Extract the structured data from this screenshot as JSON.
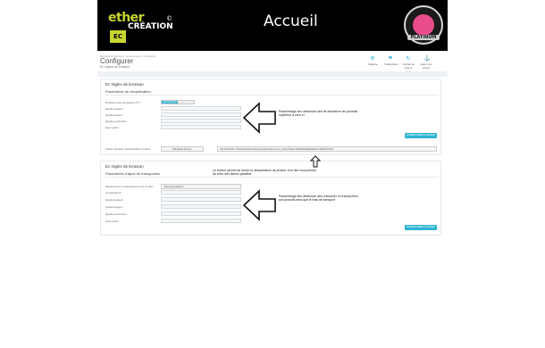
{
  "banner": {
    "logo_text": "ether",
    "logo_sub": "CRÉATION",
    "logo_mark": "EC",
    "logo_reg": "©",
    "title": "Accueil",
    "badge_text": "PLATINUM"
  },
  "topbar": {
    "breadcrumb": "Modules & Services  /  Gestionnaire  /  Configurer",
    "title": "Configurer",
    "subtitle": "Ec règles de livraison",
    "tools": [
      {
        "label": "Traduire",
        "icon": "gear-icon"
      },
      {
        "label": "Traductions",
        "icon": "flag-icon"
      },
      {
        "label": "Vérifier la mise à jour",
        "icon": "refresh-icon"
      },
      {
        "label": "Gérer vos points",
        "icon": "hook-icon"
      }
    ]
  },
  "panel1": {
    "heading": "Ec règles de livraison",
    "subheading": "Paramètres de désactivation",
    "fields": [
      "Produits sous dimension (?) ?",
      "Quelle hauteur :",
      "Quelle largeur :",
      "Quelle profondeur :",
      "Quel poids :"
    ],
    "toggle_on": "ACTIVÉ /OUI",
    "toggle_off": "",
    "save_label": "ENREGISTRER & LANCER",
    "link_label": "Tâche planifiée désactivation produits",
    "link_button": "Démarrer la cron",
    "url_value": "http://193.184.1.15/prestashop/modules/ecreglelivraison/cron_all.php?token=6db2f6b3e86a6f4e0d7ca8fba78c0a72"
  },
  "panel2": {
    "heading": "Ec règles de livraison",
    "subheading": "Paramètres d'ajout de transporteur",
    "fields": [
      "Sélectionnez le transporteur (sur le site) :",
      "Comparateur",
      "Quelle hauteur :",
      "Quelle largeur :",
      "Quelle profondeur :",
      "Quel poids :"
    ],
    "carrier_value": "Exemple platform",
    "save_label": "ENREGISTRER & LANCER"
  },
  "annotations": {
    "note1": "Paramétrage des dimension afin de désactiver les produits supérieur à ceux ci",
    "note2": "Le bouton permet de lancer la désactivation de produit, et le lien vous permet de créer des tâches parallèle",
    "note3": "Paramétrage des dimension afin d'associer un transporteur aux produits ainsi que le frais de transport"
  }
}
